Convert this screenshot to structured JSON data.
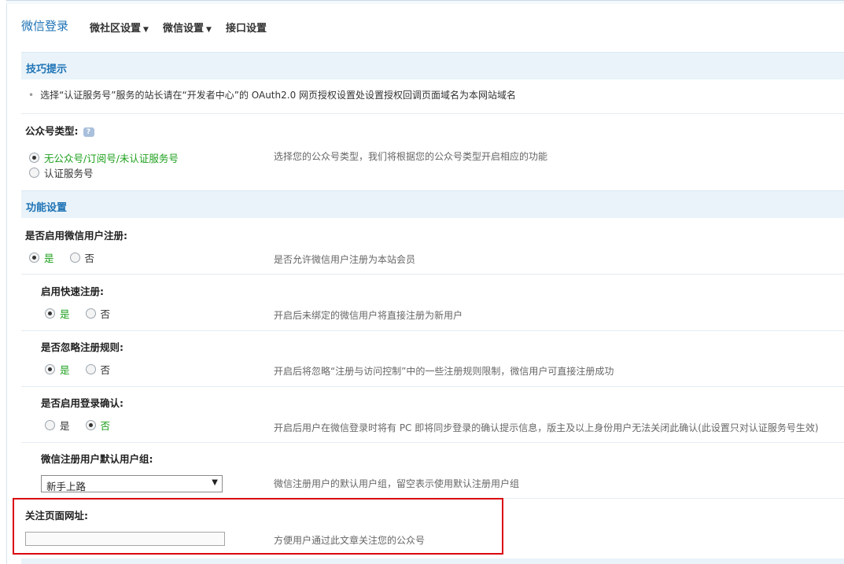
{
  "header": {
    "title": "微信登录",
    "nav": [
      {
        "label": "微社区设置",
        "caret": "▼"
      },
      {
        "label": "微信设置",
        "caret": "▼"
      },
      {
        "label": "接口设置"
      }
    ]
  },
  "tips": {
    "heading": "技巧提示",
    "bullet": "•",
    "text": "选择“认证服务号”服务的站长请在“开发者中心”的 OAuth2.0 网页授权设置处设置授权回调页面域名为本网站域名"
  },
  "account_type": {
    "label": "公众号类型:",
    "help_icon": "?",
    "options": [
      "无公众号/订阅号/未认证服务号",
      "认证服务号"
    ],
    "selected": 0,
    "hint": "选择您的公众号类型，我们将根据您的公众号类型开启相应的功能"
  },
  "function_settings": {
    "heading": "功能设置",
    "register": {
      "label": "是否启用微信用户注册:",
      "options": [
        "是",
        "否"
      ],
      "selected": 0,
      "hint": "是否允许微信用户注册为本站会员"
    },
    "quick_register": {
      "label": "启用快速注册:",
      "options": [
        "是",
        "否"
      ],
      "selected": 0,
      "hint": "开启后未绑定的微信用户将直接注册为新用户"
    },
    "ignore_rules": {
      "label": "是否忽略注册规则:",
      "options": [
        "是",
        "否"
      ],
      "selected": 0,
      "hint": "开启后将忽略“注册与访问控制”中的一些注册规则限制，微信用户可直接注册成功"
    },
    "login_confirm": {
      "label": "是否启用登录确认:",
      "options": [
        "是",
        "否"
      ],
      "selected": 1,
      "hint": "开启后用户在微信登录时将有 PC 即将同步登录的确认提示信息，版主及以上身份用户无法关闭此确认(此设置只对认证服务号生效)"
    },
    "default_group": {
      "label": "微信注册用户默认用户组:",
      "selected_value": "新手上路",
      "arrow": "▼",
      "hint": "微信注册用户的默认用户组，留空表示使用默认注册用户组"
    },
    "follow_url": {
      "label": "关注页面网址:",
      "value": "",
      "hint": "方便用户通过此文章关注您的公众号"
    }
  },
  "colors": {
    "accent": "#1e73b6",
    "section_bg": "#e9f3f9",
    "selected_option": "#1ea01e",
    "highlight_box": "#d9000d"
  }
}
